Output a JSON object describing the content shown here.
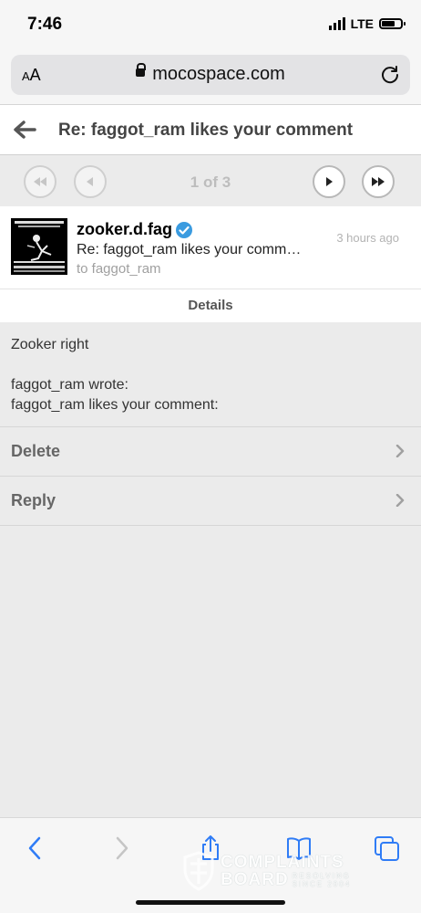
{
  "status": {
    "time": "7:46",
    "network": "LTE",
    "battery_level": 0.8
  },
  "browser": {
    "text_size_label_small": "A",
    "text_size_label_large": "A",
    "url": "mocospace.com"
  },
  "header": {
    "title": "Re: faggot_ram likes your comment"
  },
  "pager": {
    "label": "1 of 3"
  },
  "message": {
    "sender": "zooker.d.fag",
    "time": "3 hours ago",
    "subject": "Re: faggot_ram likes your comment",
    "to": "to faggot_ram"
  },
  "details_tab": "Details",
  "body": {
    "line1": "Zooker right",
    "line2": "faggot_ram wrote:",
    "line3": "faggot_ram likes your comment:"
  },
  "actions": [
    {
      "label": "Delete"
    },
    {
      "label": "Reply"
    }
  ],
  "watermark": {
    "main1": "COMPLAINTS",
    "main2": "BOARD",
    "sub1": "RESOLVING",
    "sub2": "SINCE 2004"
  },
  "colors": {
    "ios_blue": "#2f7cf6",
    "verified_blue": "#3a9be0"
  }
}
